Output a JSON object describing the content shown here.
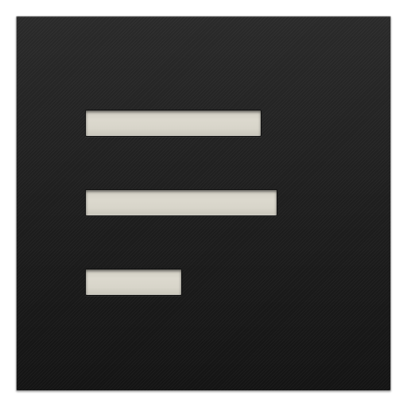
{
  "icon": {
    "name": "text-align-left-icon",
    "tile_color": "#1e1e1e",
    "bar_color": "#d8d5ca",
    "lines": [
      {
        "name": "line-long"
      },
      {
        "name": "line-longest"
      },
      {
        "name": "line-short"
      }
    ]
  }
}
